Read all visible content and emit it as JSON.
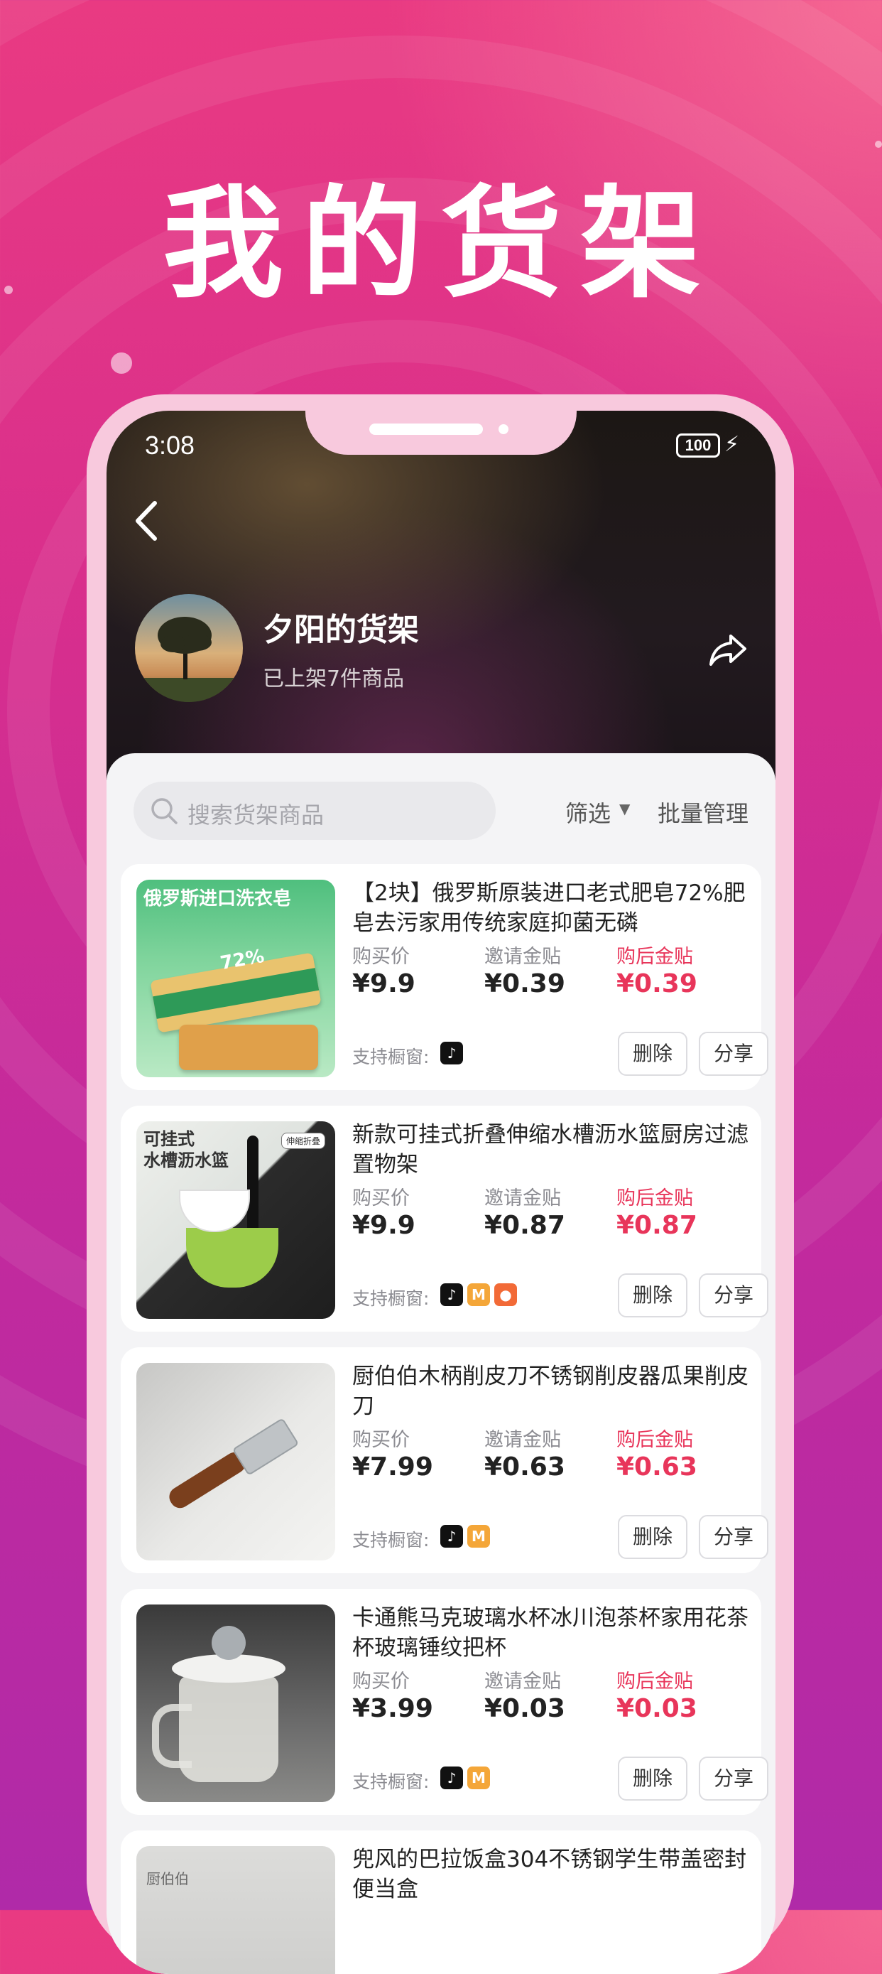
{
  "headline": "我的货架",
  "status_bar": {
    "time": "3:08",
    "battery": "100"
  },
  "shelf": {
    "title": "夕阳的货架",
    "subtitle": "已上架7件商品"
  },
  "toolbar": {
    "search_placeholder": "搜索货架商品",
    "filter_label": "筛选",
    "batch_label": "批量管理"
  },
  "labels": {
    "buy_price": "购买价",
    "invite_subsidy": "邀请金贴",
    "after_subsidy": "购后金贴",
    "support": "支持橱窗:",
    "delete": "删除",
    "share": "分享"
  },
  "products": [
    {
      "title": "【2块】俄罗斯原装进口老式肥皂72%肥皂去污家用传统家庭抑菌无磷",
      "buy_price": "¥9.9",
      "invite_subsidy": "¥0.39",
      "after_subsidy": "¥0.39",
      "platforms": [
        "tiktok-icon"
      ],
      "thumb_caption": "俄罗斯进口洗衣皂",
      "thumb_badge": "72%"
    },
    {
      "title": "新款可挂式折叠伸缩水槽沥水篮厨房过滤置物架",
      "buy_price": "¥9.9",
      "invite_subsidy": "¥0.87",
      "after_subsidy": "¥0.87",
      "platforms": [
        "tiktok-icon",
        "mango-icon",
        "kuaishou-icon"
      ],
      "thumb_caption": "可挂式\n水槽沥水篮",
      "thumb_badge": "伸缩折叠"
    },
    {
      "title": "厨伯伯木柄削皮刀不锈钢削皮器瓜果削皮刀",
      "buy_price": "¥7.99",
      "invite_subsidy": "¥0.63",
      "after_subsidy": "¥0.63",
      "platforms": [
        "tiktok-icon",
        "mango-icon"
      ]
    },
    {
      "title": "卡通熊马克玻璃水杯冰川泡茶杯家用花茶杯玻璃锤纹把杯",
      "buy_price": "¥3.99",
      "invite_subsidy": "¥0.03",
      "after_subsidy": "¥0.03",
      "platforms": [
        "tiktok-icon",
        "mango-icon"
      ]
    },
    {
      "title": "兜风的巴拉饭盒304不锈钢学生带盖密封便当盒",
      "thumb_caption": "厨伯伯"
    }
  ],
  "colors": {
    "accent_red": "#e8355a",
    "background_top": "#e93a82",
    "background_bottom": "#b02aa8"
  }
}
